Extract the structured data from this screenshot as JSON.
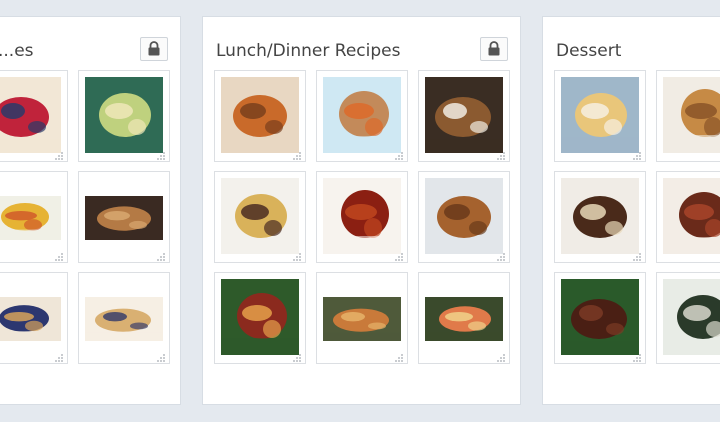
{
  "boards": [
    {
      "title": "...es",
      "lock_icon": "lock-icon",
      "pins": [
        {
          "name": "pancake-berries-pin",
          "icon": "food-photo",
          "colors": [
            "#f2e7d6",
            "#c0233b",
            "#2a3a6a"
          ]
        },
        {
          "name": "egg-salad-pin",
          "icon": "food-photo",
          "colors": [
            "#2f6b55",
            "#bfd17e",
            "#efe7b8"
          ]
        },
        {
          "name": "veggie-frittata-pin",
          "icon": "food-photo",
          "colors": [
            "#f0f0e6",
            "#e6b334",
            "#d05a2a"
          ]
        },
        {
          "name": "muffins-tray-pin",
          "icon": "food-photo",
          "colors": [
            "#3a2a22",
            "#b47a45",
            "#d8a870"
          ]
        },
        {
          "name": "pancakes-blueberries-pin",
          "icon": "food-photo",
          "colors": [
            "#efe6d8",
            "#2c3770",
            "#d7a35a"
          ]
        },
        {
          "name": "blueberry-muffins-pin",
          "icon": "food-photo",
          "colors": [
            "#f6efe4",
            "#d9b072",
            "#3a3f6a"
          ]
        }
      ]
    },
    {
      "title": "Lunch/Dinner Recipes",
      "lock_icon": "lock-icon",
      "pins": [
        {
          "name": "roast-chicken-pin",
          "icon": "food-photo",
          "colors": [
            "#e8d7c2",
            "#c96a2a",
            "#7a3f1c"
          ]
        },
        {
          "name": "quinoa-salad-pin",
          "icon": "food-photo",
          "colors": [
            "#cfe8f3",
            "#c38a5a",
            "#dd6a2a"
          ]
        },
        {
          "name": "steak-plate-pin",
          "icon": "food-photo",
          "colors": [
            "#3a2d23",
            "#8b5a30",
            "#f1ece3"
          ]
        },
        {
          "name": "beef-noodles-pin",
          "icon": "food-photo",
          "colors": [
            "#f3f1ec",
            "#d9b25a",
            "#4a2c22"
          ]
        },
        {
          "name": "meatballs-sauce-pin",
          "icon": "food-photo",
          "colors": [
            "#f7f3ee",
            "#8b1f12",
            "#c0461f"
          ]
        },
        {
          "name": "pork-chop-pin",
          "icon": "food-photo",
          "colors": [
            "#e2e6ea",
            "#a5622e",
            "#6a3a1a"
          ]
        },
        {
          "name": "glazed-chicken-pin",
          "icon": "food-photo",
          "colors": [
            "#2e5a2a",
            "#8b2a1e",
            "#e5a04a"
          ]
        },
        {
          "name": "grilled-salmon-pin",
          "icon": "food-photo",
          "colors": [
            "#4f5a3a",
            "#c97a3a",
            "#e6b36a"
          ]
        },
        {
          "name": "salmon-herbs-pin",
          "icon": "food-photo",
          "colors": [
            "#3a4a2c",
            "#e07a4a",
            "#f0d28a"
          ]
        }
      ]
    },
    {
      "title": "Dessert",
      "lock_icon": "lock-icon",
      "pins": [
        {
          "name": "pound-cake-pin",
          "icon": "food-photo",
          "colors": [
            "#9fb7c9",
            "#e9c67a",
            "#f6efe2"
          ]
        },
        {
          "name": "cookie-stack-pin",
          "icon": "food-photo",
          "colors": [
            "#f1ece4",
            "#c68a45",
            "#8a5428"
          ]
        },
        {
          "name": "tiramisu-pin",
          "icon": "food-photo",
          "colors": [
            "#f0ece6",
            "#4a2a1a",
            "#e8d8b8"
          ]
        },
        {
          "name": "brownies-pin",
          "icon": "food-photo",
          "colors": [
            "#f3ede6",
            "#6a2a1a",
            "#a8442a"
          ]
        },
        {
          "name": "fudge-pin",
          "icon": "food-photo",
          "colors": [
            "#2a5a2a",
            "#4a1f14",
            "#7a3a24"
          ]
        },
        {
          "name": "cheesecake-pin",
          "icon": "food-photo",
          "colors": [
            "#e8ece6",
            "#2a3a2a",
            "#d8d8cc"
          ]
        }
      ]
    }
  ]
}
